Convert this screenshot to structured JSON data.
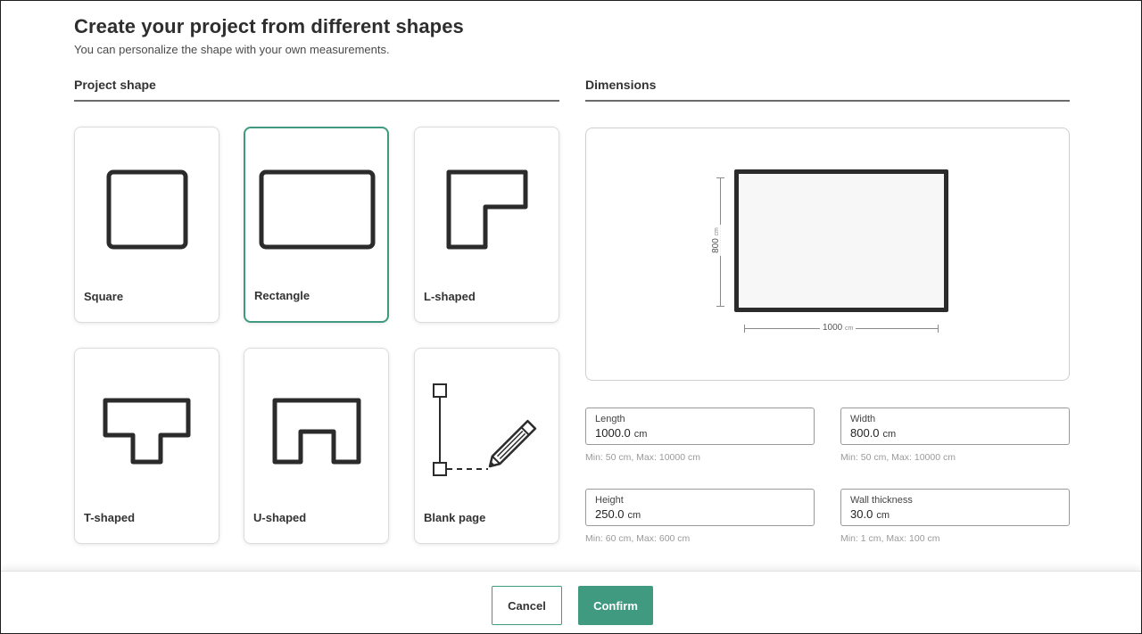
{
  "header": {
    "title": "Create your project from different shapes",
    "subtitle": "You can personalize the shape with your own measurements."
  },
  "project_shape": {
    "heading": "Project shape",
    "selected": "Rectangle",
    "shapes": [
      {
        "label": "Square",
        "icon": "square-shape-icon"
      },
      {
        "label": "Rectangle",
        "icon": "rectangle-shape-icon"
      },
      {
        "label": "L-shaped",
        "icon": "l-shape-icon"
      },
      {
        "label": "T-shaped",
        "icon": "t-shape-icon"
      },
      {
        "label": "U-shaped",
        "icon": "u-shape-icon"
      },
      {
        "label": "Blank page",
        "icon": "blank-page-pencil-icon"
      }
    ]
  },
  "dimensions": {
    "heading": "Dimensions",
    "preview": {
      "width_value": "1000",
      "height_value": "800",
      "unit": "cm"
    },
    "fields": [
      {
        "label": "Length",
        "value": "1000.0",
        "unit": "cm",
        "hint": "Min: 50 cm, Max: 10000 cm"
      },
      {
        "label": "Width",
        "value": "800.0",
        "unit": "cm",
        "hint": "Min: 50 cm, Max: 10000 cm"
      },
      {
        "label": "Height",
        "value": "250.0",
        "unit": "cm",
        "hint": "Min: 60 cm, Max: 600 cm"
      },
      {
        "label": "Wall thickness",
        "value": "30.0",
        "unit": "cm",
        "hint": "Min: 1 cm, Max: 100 cm"
      }
    ]
  },
  "footer": {
    "cancel_label": "Cancel",
    "confirm_label": "Confirm"
  },
  "colors": {
    "accent": "#3f9a80",
    "shape_stroke": "#2b2b2b"
  }
}
